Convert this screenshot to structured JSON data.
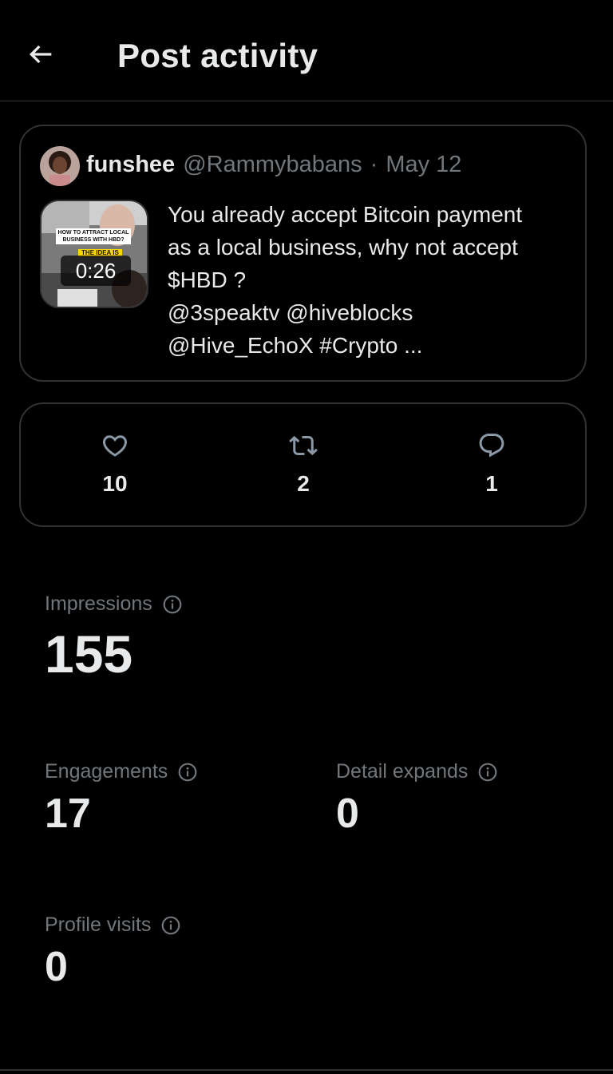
{
  "header": {
    "title": "Post activity"
  },
  "post": {
    "author_name": "funshee",
    "author_handle": "@Rammybabans",
    "separator": "·",
    "date": "May 12",
    "text_line1": "You already accept Bitcoin payment",
    "text_line2": "as a local business, why not accept",
    "text_line3": "$HBD ?",
    "text_line4": "@3speaktv @hiveblocks",
    "text_line5": "@Hive_EchoX #Crypto ...",
    "video_duration": "0:26",
    "thumbnail_caption_1": "HOW TO ATTRACT LOCAL BUSINESS WITH HBD?",
    "thumbnail_caption_2": "THE IDEA IS"
  },
  "engagement_counts": {
    "likes": "10",
    "reposts": "2",
    "replies": "1",
    "icons": [
      "heart-icon",
      "repost-icon",
      "reply-icon"
    ]
  },
  "metrics": {
    "impressions_label": "Impressions",
    "impressions_value": "155",
    "engagements_label": "Engagements",
    "engagements_value": "17",
    "detail_expands_label": "Detail expands",
    "detail_expands_value": "0",
    "profile_visits_label": "Profile visits",
    "profile_visits_value": "0"
  },
  "colors": {
    "background": "#000000",
    "primary_text": "#e7e9ea",
    "secondary_text": "#71767b",
    "border": "#2f3336"
  }
}
